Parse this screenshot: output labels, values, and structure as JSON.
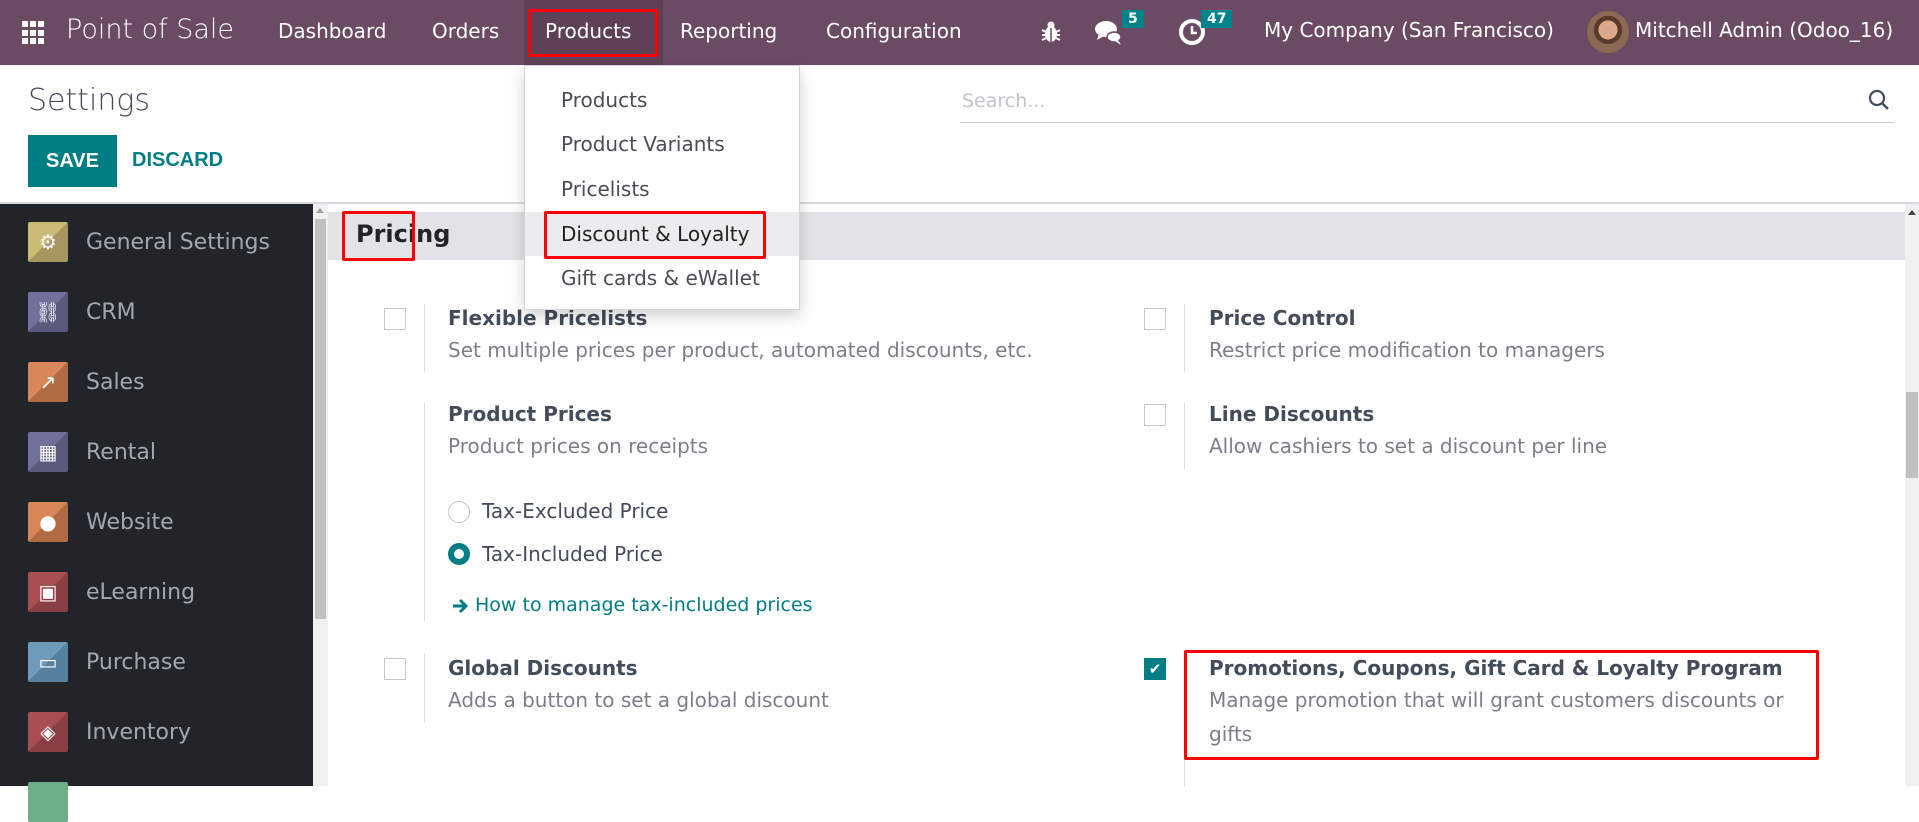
{
  "navbar": {
    "brand": "Point of Sale",
    "menu": [
      "Dashboard",
      "Orders",
      "Products",
      "Reporting",
      "Configuration"
    ],
    "active_menu": "Products",
    "messages_count": "5",
    "activities_count": "47",
    "company": "My Company (San Francisco)",
    "user": "Mitchell Admin (Odoo_16)",
    "icons": {
      "apps": "apps-grid-icon",
      "debug": "bug-icon",
      "messages": "chat-icon",
      "activities": "clock-icon"
    }
  },
  "products_dropdown": {
    "items": [
      "Products",
      "Product Variants",
      "Pricelists",
      "Discount & Loyalty",
      "Gift cards & eWallet"
    ],
    "highlighted": "Discount & Loyalty"
  },
  "control_panel": {
    "title": "Settings",
    "save_label": "SAVE",
    "discard_label": "DISCARD",
    "search_placeholder": "Search..."
  },
  "sidebar": {
    "items": [
      {
        "label": "General Settings",
        "icon": "gear-icon",
        "color": "#c2b26a"
      },
      {
        "label": "CRM",
        "icon": "handshake-icon",
        "color": "#6d6c8f"
      },
      {
        "label": "Sales",
        "icon": "chart-up-icon",
        "color": "#d1814f"
      },
      {
        "label": "Rental",
        "icon": "calendar-icon",
        "color": "#6d6c8f"
      },
      {
        "label": "Website",
        "icon": "globe-icon",
        "color": "#d1814f"
      },
      {
        "label": "eLearning",
        "icon": "presentation-icon",
        "color": "#a74b4f"
      },
      {
        "label": "Purchase",
        "icon": "credit-card-icon",
        "color": "#6b95b3"
      },
      {
        "label": "Inventory",
        "icon": "box-icon",
        "color": "#a74b4f"
      }
    ]
  },
  "section": {
    "title": "Pricing",
    "settings": {
      "flexible_pricelists": {
        "title": "Flexible Pricelists",
        "desc": "Set multiple prices per product, automated discounts, etc.",
        "checked": false
      },
      "price_control": {
        "title": "Price Control",
        "desc": "Restrict price modification to managers",
        "checked": false
      },
      "product_prices": {
        "title": "Product Prices",
        "desc": "Product prices on receipts",
        "options": [
          "Tax-Excluded Price",
          "Tax-Included Price"
        ],
        "selected": "Tax-Included Price",
        "link": "How to manage tax-included prices"
      },
      "line_discounts": {
        "title": "Line Discounts",
        "desc": "Allow cashiers to set a discount per line",
        "checked": false
      },
      "global_discounts": {
        "title": "Global Discounts",
        "desc": "Adds a button to set a global discount",
        "checked": false
      },
      "promotions": {
        "title": "Promotions, Coupons, Gift Card & Loyalty Program",
        "desc": "Manage promotion that will grant customers discounts or gifts",
        "checked": true
      }
    }
  },
  "colors": {
    "navbar": "#6b4b64",
    "primary": "#017e84",
    "badge": "#00848a",
    "highlight": "#ff0000"
  }
}
